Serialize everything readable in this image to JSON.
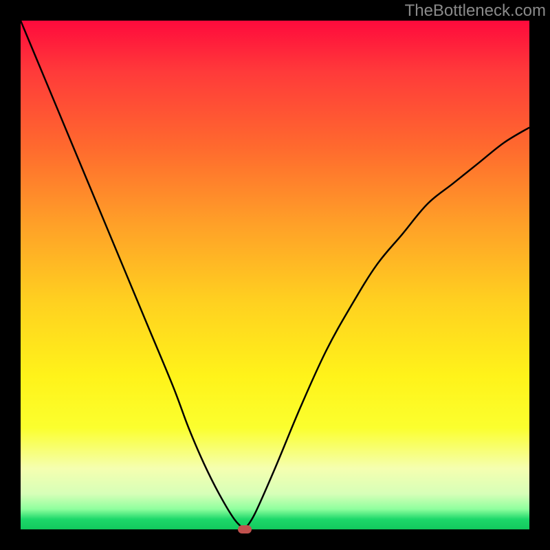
{
  "watermark": "TheBottleneck.com",
  "chart_data": {
    "type": "line",
    "title": "",
    "xlabel": "",
    "ylabel": "",
    "xlim": [
      0,
      100
    ],
    "ylim": [
      0,
      100
    ],
    "grid": false,
    "legend": false,
    "background": {
      "top_color": "#ff0a3c",
      "bottom_color": "#12c85d",
      "description": "vertical gradient red→orange→yellow→green"
    },
    "series": [
      {
        "name": "bottleneck_curve_left",
        "x": [
          0,
          5,
          10,
          15,
          20,
          25,
          30,
          33,
          36,
          39,
          42,
          44
        ],
        "values": [
          100,
          88,
          76,
          64,
          52,
          40,
          28,
          20,
          13,
          7,
          2,
          0
        ],
        "stroke": "#000000"
      },
      {
        "name": "bottleneck_curve_right",
        "x": [
          44,
          46,
          50,
          55,
          60,
          65,
          70,
          75,
          80,
          85,
          90,
          95,
          100
        ],
        "values": [
          0,
          3,
          12,
          24,
          35,
          44,
          52,
          58,
          64,
          68,
          72,
          76,
          79
        ],
        "stroke": "#000000"
      }
    ],
    "marker": {
      "x": 44,
      "y": 0,
      "color": "#c1514e",
      "shape": "rounded-rect"
    }
  }
}
